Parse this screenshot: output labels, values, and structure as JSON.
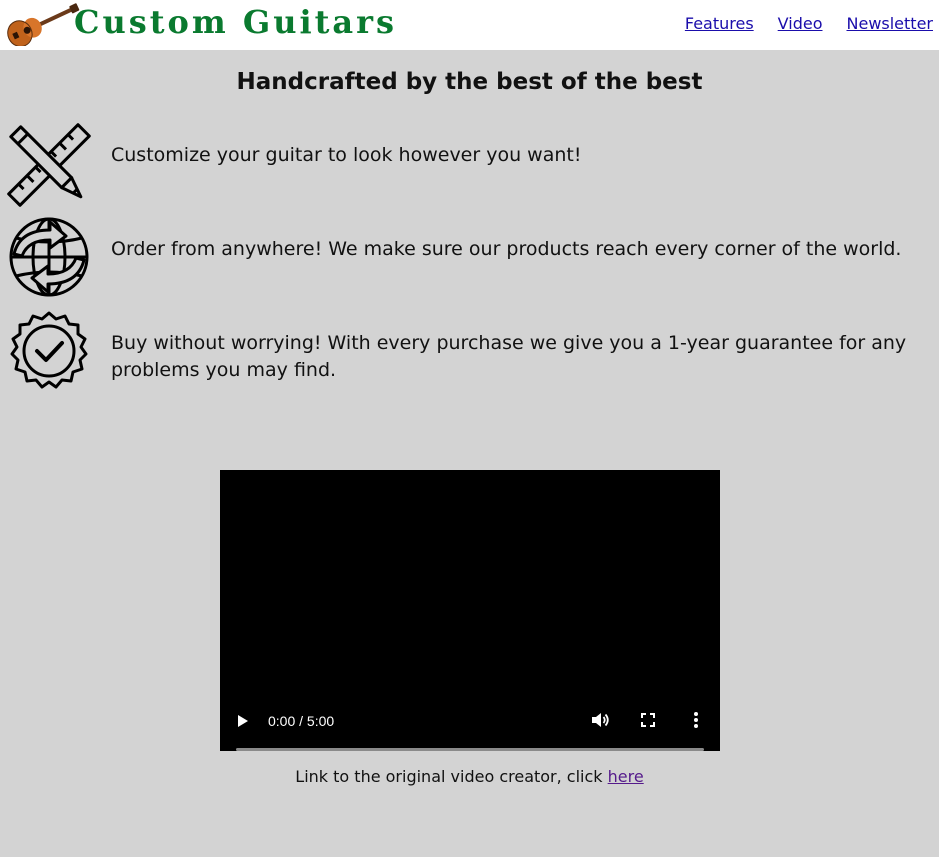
{
  "header": {
    "brand_name": "Custom Guitars",
    "nav": {
      "features": "Features",
      "video": "Video",
      "newsletter": "Newsletter"
    }
  },
  "main": {
    "headline": "Handcrafted by the best of the best",
    "features": [
      {
        "icon": "pencil-ruler-icon",
        "text": "Customize your guitar to look however you want!"
      },
      {
        "icon": "globe-arrows-icon",
        "text": "Order from anywhere! We make sure our products reach every corner of the world."
      },
      {
        "icon": "badge-check-icon",
        "text": "Buy without worrying! With every purchase we give you a 1-year guarantee for any problems you may find."
      }
    ]
  },
  "video": {
    "time": "0:00 / 5:00",
    "progress": 0
  },
  "credit": {
    "text": "Link to the original video creator, click ",
    "link_label": "here"
  },
  "colors": {
    "brand": "#0a7a2f",
    "link": "#1a0dab",
    "visited_link": "#551a8b",
    "background": "#d3d3d3"
  }
}
